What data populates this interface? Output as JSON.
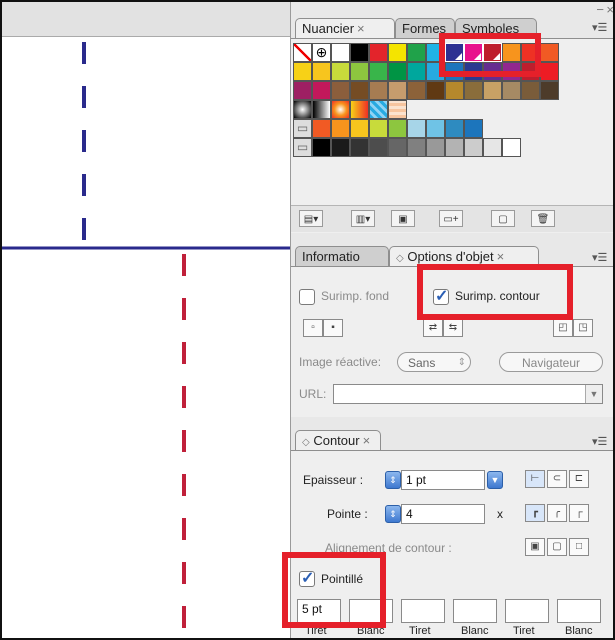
{
  "swatches_panel": {
    "tabs": [
      {
        "label": "Nuancier",
        "close": "×"
      },
      {
        "label": "Formes",
        "close": ""
      },
      {
        "label": "Symboles",
        "close": ""
      }
    ],
    "menu_icon": "panel-menu-icon",
    "bottom_buttons": [
      "swatch-libraries-icon",
      "show-kinds-icon",
      "swatch-options-icon",
      "new-color-group-icon",
      "new-swatch-icon",
      "delete-swatch-icon"
    ]
  },
  "object_options_panel": {
    "tabs": [
      {
        "label": "Informatio",
        "close": ""
      },
      {
        "label": "Options d'objet",
        "close": "×"
      }
    ],
    "overprint_fill_label": "Surimp. fond",
    "overprint_stroke_label": "Surimp. contour",
    "overprint_fill_checked": false,
    "overprint_stroke_checked": true,
    "image_map_label": "Image réactive:",
    "image_map_value": "Sans",
    "browser_button": "Navigateur",
    "url_label": "URL:",
    "url_value": ""
  },
  "stroke_panel": {
    "tab_label": "Contour",
    "tab_close": "×",
    "weight_label": "Epaisseur :",
    "weight_value": "1 pt",
    "miter_label": "Pointe :",
    "miter_value": "4",
    "miter_unit": "x",
    "align_label": "Alignement de contour :",
    "dashed_label": "Pointillé",
    "dashed_checked": true,
    "dash_fields": [
      {
        "value": "5 pt",
        "label": "Tiret"
      },
      {
        "value": "",
        "label": "Blanc"
      },
      {
        "value": "",
        "label": "Tiret"
      },
      {
        "value": "",
        "label": "Blanc"
      },
      {
        "value": "",
        "label": "Tiret"
      },
      {
        "value": "",
        "label": "Blanc"
      }
    ]
  },
  "colors": {
    "guide_blue": "#2a2a8c",
    "dash_red": "#c0203a",
    "highlight_red": "#e5202a"
  }
}
